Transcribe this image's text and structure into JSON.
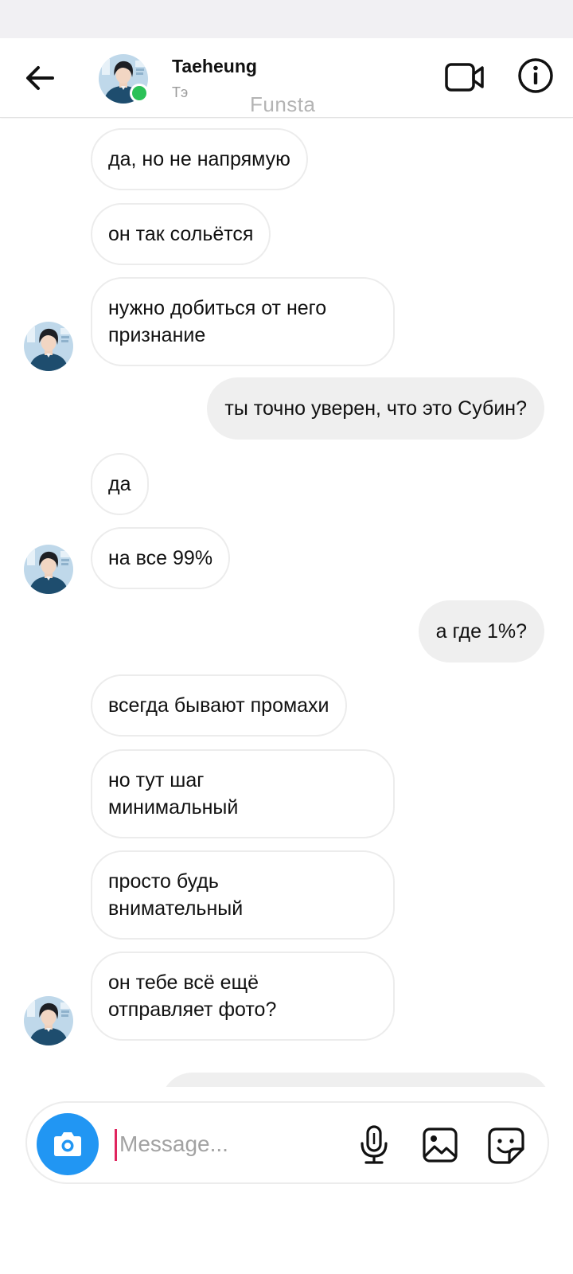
{
  "header": {
    "contact_name": "Taeheung",
    "contact_subtitle": "Тэ",
    "watermark": "Funsta"
  },
  "messages": [
    {
      "text": "да, но не напрямую",
      "direction": "incoming",
      "avatar": false
    },
    {
      "text": "он так сольётся",
      "direction": "incoming",
      "avatar": false
    },
    {
      "text": "нужно добиться от него\nпризнание",
      "direction": "incoming",
      "avatar": true
    },
    {
      "text": "ты точно уверен, что это Субин?",
      "direction": "outgoing",
      "avatar": false
    },
    {
      "text": "да",
      "direction": "incoming",
      "avatar": false
    },
    {
      "text": "на все 99%",
      "direction": "incoming",
      "avatar": true
    },
    {
      "text": "а где 1%?",
      "direction": "outgoing",
      "avatar": false
    },
    {
      "text": "всегда бывают промахи",
      "direction": "incoming",
      "avatar": false
    },
    {
      "text": "но тут шаг\nминимальный",
      "direction": "incoming",
      "avatar": false
    },
    {
      "text": "просто будь\nвнимательный",
      "direction": "incoming",
      "avatar": false
    },
    {
      "text": "он тебе всё ещё\nотправляет фото?",
      "direction": "incoming",
      "avatar": true
    }
  ],
  "composer": {
    "placeholder": "Message...",
    "value": ""
  },
  "colors": {
    "accent_blue": "#2196f3",
    "online_green": "#2bc157",
    "outgoing_bubble": "#efefef",
    "incoming_border": "#ececec",
    "cursor_pink": "#e0245e"
  },
  "icons": {
    "back": "arrow-left-icon",
    "video": "video-camera-icon",
    "info": "info-icon",
    "camera": "camera-icon",
    "mic": "microphone-icon",
    "gallery": "image-icon",
    "sticker": "sticker-icon"
  }
}
